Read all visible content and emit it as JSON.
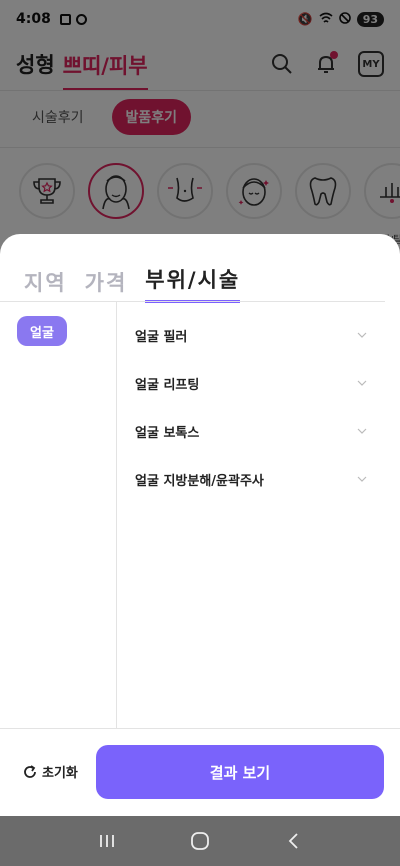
{
  "status_bar": {
    "time": "4:08",
    "battery": "93"
  },
  "header": {
    "brand": "성형",
    "brand_accent": "쁘띠/피부",
    "my_label": "MY",
    "icons": [
      "search-icon",
      "bell-icon",
      "my-page-icon"
    ]
  },
  "review_tabs": [
    {
      "label": "시술후기",
      "active": false
    },
    {
      "label": "발품후기",
      "active": true
    }
  ],
  "categories": [
    {
      "label": "추천",
      "icon": "trophy-icon",
      "active": false
    },
    {
      "label": "얼굴",
      "icon": "face-icon",
      "active": true
    },
    {
      "label": "체형",
      "icon": "body-icon",
      "active": false
    },
    {
      "label": "피부",
      "icon": "skin-icon",
      "active": false
    },
    {
      "label": "치과",
      "icon": "tooth-icon",
      "active": false
    },
    {
      "label": "두피/탈모",
      "icon": "scalp-icon",
      "active": false
    }
  ],
  "sheet": {
    "filter_tabs": [
      {
        "label": "지역",
        "active": false
      },
      {
        "label": "가격",
        "active": false
      },
      {
        "label": "부위/시술",
        "active": true
      }
    ],
    "selected_part": "얼굴",
    "procedures": [
      {
        "label": "얼굴 필러"
      },
      {
        "label": "얼굴 리프팅"
      },
      {
        "label": "얼굴 보톡스"
      },
      {
        "label": "얼굴 지방분해/윤곽주사"
      }
    ],
    "reset_label": "초기화",
    "result_label": "결과 보기"
  },
  "colors": {
    "accent_pink": "#e0245e",
    "accent_purple": "#7a63fb",
    "chip_purple": "#8a78f0"
  }
}
